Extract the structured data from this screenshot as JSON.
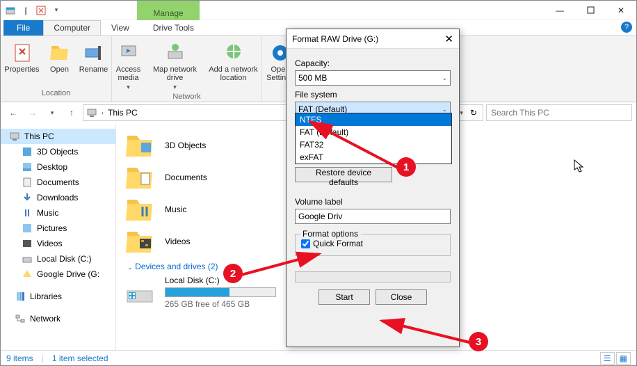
{
  "window": {
    "tab_manage": "Manage",
    "title": "This PC"
  },
  "tabs": {
    "file": "File",
    "computer": "Computer",
    "view": "View",
    "drivetools": "Drive Tools"
  },
  "ribbon": {
    "location": {
      "properties": "Properties",
      "open": "Open",
      "rename": "Rename",
      "group": "Location"
    },
    "network": {
      "access_media": "Access media",
      "map_drive": "Map network drive",
      "add_loc": "Add a network location",
      "group": "Network"
    },
    "system": {
      "open_settings": "Open Settings"
    }
  },
  "address": {
    "location": "This PC",
    "search_ph": "Search This PC"
  },
  "sidebar": {
    "root": "This PC",
    "items": [
      "3D Objects",
      "Desktop",
      "Documents",
      "Downloads",
      "Music",
      "Pictures",
      "Videos",
      "Local Disk (C:)",
      "Google Drive (G:"
    ],
    "libraries": "Libraries",
    "network": "Network"
  },
  "content": {
    "folders": [
      "3D Objects",
      "Documents",
      "Music",
      "Videos"
    ],
    "section": "Devices and drives (2)",
    "drive": {
      "name": "Local Disk (C:)",
      "info": "265 GB free of 465 GB"
    }
  },
  "dialog": {
    "title": "Format RAW Drive (G:)",
    "capacity_lbl": "Capacity:",
    "capacity_val": "500 MB",
    "fs_lbl": "File system",
    "fs_val": "FAT (Default)",
    "fs_opts": [
      "NTFS",
      "FAT (Default)",
      "FAT32",
      "exFAT"
    ],
    "restore": "Restore device defaults",
    "vol_lbl": "Volume label",
    "vol_val": "Google Driv",
    "fmt_opts_lbl": "Format options",
    "quick": "Quick Format",
    "start": "Start",
    "close": "Close"
  },
  "status": {
    "items": "9 items",
    "selected": "1 item selected"
  },
  "anno": {
    "a1": "1",
    "a2": "2",
    "a3": "3"
  }
}
